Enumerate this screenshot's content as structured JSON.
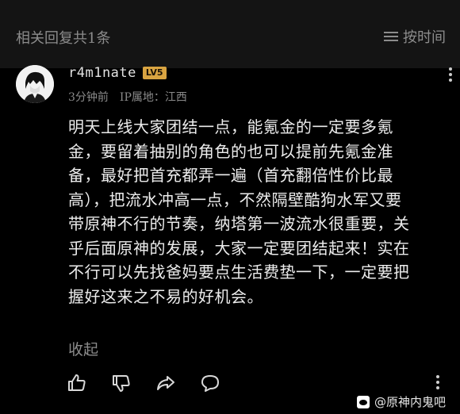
{
  "header": {
    "title": "相关回复共1条",
    "sort_label": "按时间"
  },
  "comment": {
    "username": "r4m1nate",
    "level_badge": "LV5",
    "time": "3分钟前",
    "ip_location": "IP属地：江西",
    "body_lines": [
      "明天上线大家团结一点，能氪金的一定要多氪",
      "金，要留着抽别的角色的也可以提前先氪金准",
      "备，最好把首充都弄一遍（首充翻倍性价比最",
      "高），把流水冲高一点，不然隔壁酷狗水军又要",
      "带原神不行的节奏，纳塔第一波流水很重要，关",
      "乎后面原神的发展，大家一定要团结起来！实在",
      "不行可以先找爸妈要点生活费垫一下，一定要把",
      "握好这来之不易的好机会。"
    ],
    "collapse_label": "收起"
  },
  "watermark": {
    "text": "@原神内鬼吧"
  },
  "colors": {
    "background": "#000000",
    "header_bg": "#141414",
    "badge": "#d9a441",
    "muted_text": "#8c8c8c"
  },
  "icons": {
    "sort": "sort-lines-icon",
    "more": "more-vertical-icon",
    "like": "thumbs-up-icon",
    "dislike": "thumbs-down-icon",
    "share": "share-icon",
    "reply": "comment-icon",
    "logo": "weibo-logo-icon"
  }
}
